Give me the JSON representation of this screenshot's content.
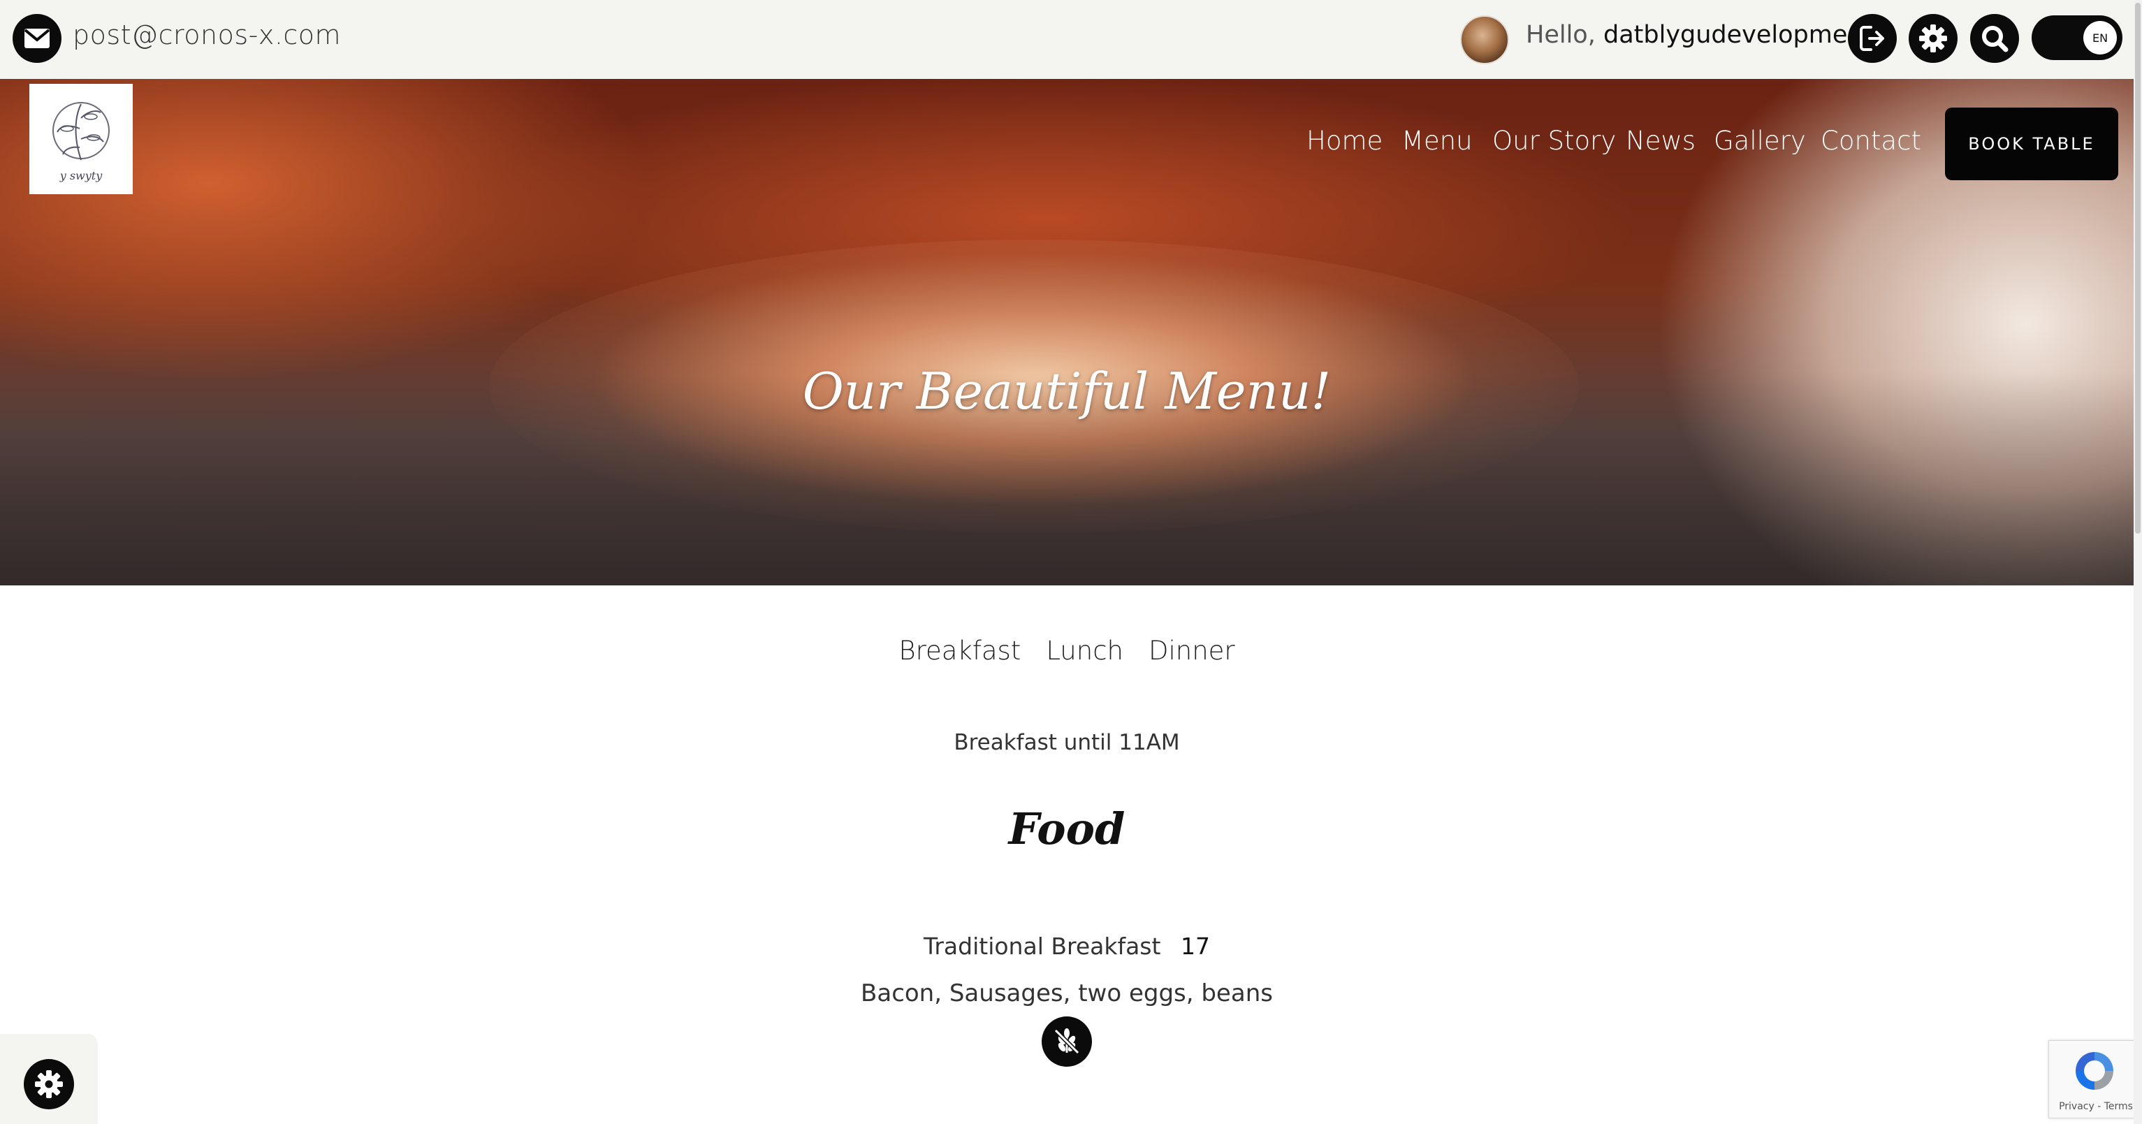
{
  "topbar": {
    "email": "post@cronos-x.com",
    "greeting": "Hello,",
    "username": "datblygudevelopment",
    "language": "EN"
  },
  "nav": {
    "items": [
      "Home",
      "Menu",
      "Our Story",
      "News",
      "Gallery",
      "Contact"
    ],
    "book_label": "BOOK TABLE"
  },
  "logo": {
    "text": "y swyty"
  },
  "hero": {
    "title": "Our Beautiful Menu!"
  },
  "menu": {
    "tabs": [
      "Breakfast",
      "Lunch",
      "Dinner"
    ],
    "subtitle": "Breakfast until 11AM",
    "section": "Food",
    "item": {
      "name": "Traditional Breakfast",
      "price": "17",
      "description": "Bacon, Sausages, two eggs, beans"
    }
  },
  "recaptcha": {
    "links": "Privacy - Terms"
  },
  "icons": {
    "email": "envelope-icon",
    "logout": "logout-icon",
    "settings": "gear-icon",
    "search": "search-icon",
    "diet": "gluten-free-icon",
    "cookie": "gear-icon"
  },
  "colors": {
    "topbar_bg": "#f4f4f1",
    "accent_dark": "#0b0b0b",
    "text": "#333333"
  }
}
